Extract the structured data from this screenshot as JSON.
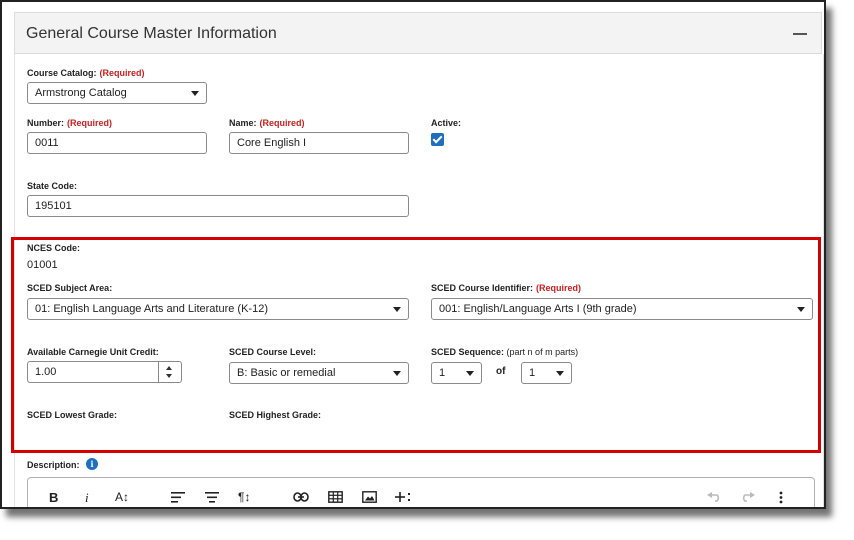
{
  "panel": {
    "title": "General Course Master Information"
  },
  "required_text": "(Required)",
  "course_catalog": {
    "label": "Course Catalog:",
    "value": "Armstrong Catalog"
  },
  "number": {
    "label": "Number:",
    "value": "0011"
  },
  "name": {
    "label": "Name:",
    "value": "Core English I"
  },
  "active": {
    "label": "Active:",
    "checked": true
  },
  "state_code": {
    "label": "State Code:",
    "value": "195101"
  },
  "nces_code": {
    "label": "NCES Code:",
    "value": "01001"
  },
  "sced_subject_area": {
    "label": "SCED Subject Area:",
    "value": "01: English Language Arts and Literature (K-12)"
  },
  "sced_course_identifier": {
    "label": "SCED Course Identifier:",
    "value": "001: English/Language Arts I (9th grade)"
  },
  "carnegie_credit": {
    "label": "Available Carnegie Unit Credit:",
    "value": "1.00"
  },
  "sced_course_level": {
    "label": "SCED Course Level:",
    "value": "B: Basic or remedial"
  },
  "sced_sequence": {
    "label": "SCED Sequence:",
    "hint": "(part n of m parts)",
    "n_value": "1",
    "of_text": "of",
    "m_value": "1"
  },
  "sced_lowest_grade": {
    "label": "SCED Lowest Grade:"
  },
  "sced_highest_grade": {
    "label": "SCED Highest Grade:"
  },
  "description": {
    "label": "Description:"
  },
  "toolbar": {
    "bold": "B",
    "italic": "i",
    "font_size": "A↕",
    "paragraph": "¶↕"
  },
  "colors": {
    "highlight": "#d40000",
    "required": "#c81e1e",
    "accent": "#1f6fbf"
  }
}
